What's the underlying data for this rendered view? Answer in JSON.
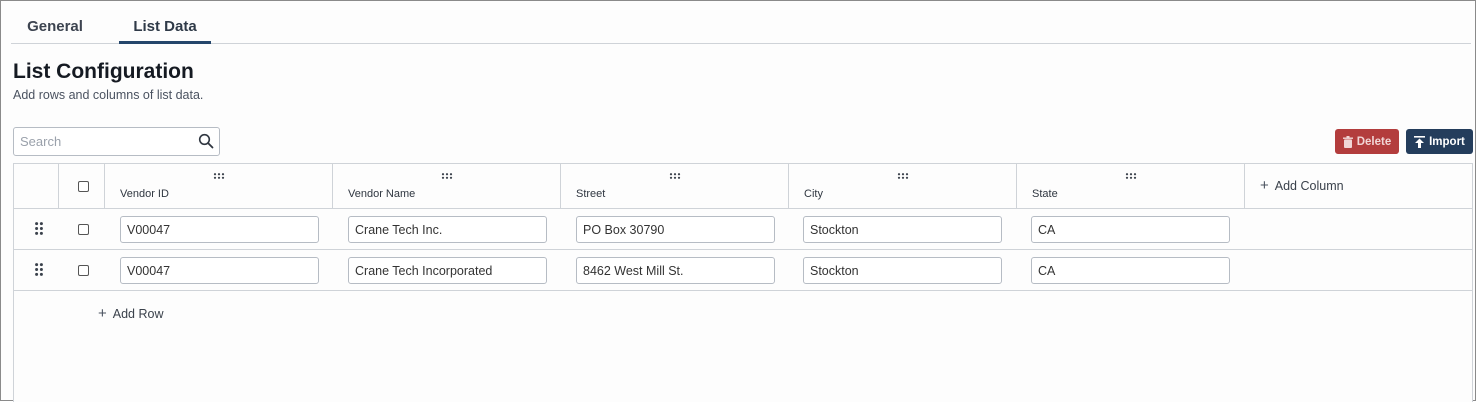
{
  "tabs": [
    {
      "label": "General"
    },
    {
      "label": "List Data"
    }
  ],
  "page": {
    "title": "List Configuration",
    "subtitle": "Add rows and columns of list data."
  },
  "search": {
    "placeholder": "Search",
    "value": ""
  },
  "toolbar": {
    "delete_label": "Delete",
    "import_label": "Import"
  },
  "table": {
    "columns": [
      "Vendor ID",
      "Vendor Name",
      "Street",
      "City",
      "State"
    ],
    "rows": [
      [
        "V00047",
        "Crane Tech Inc.",
        "PO Box 30790",
        "Stockton",
        "CA"
      ],
      [
        "V00047",
        "Crane Tech Incorporated",
        "8462 West Mill St.",
        "Stockton",
        "CA"
      ]
    ],
    "add_column_label": "Add Column",
    "add_row_label": "Add Row"
  },
  "colors": {
    "accent": "#24466b",
    "delete": "#b33d3d",
    "import": "#243d5c",
    "border": "#cfd3d8"
  },
  "icons": {
    "search": "search-icon",
    "delete": "trash-icon",
    "import": "upload-icon",
    "column_grip": "grip-horizontal-icon",
    "row_drag": "drag-handle-icon",
    "add": "plus-icon"
  }
}
